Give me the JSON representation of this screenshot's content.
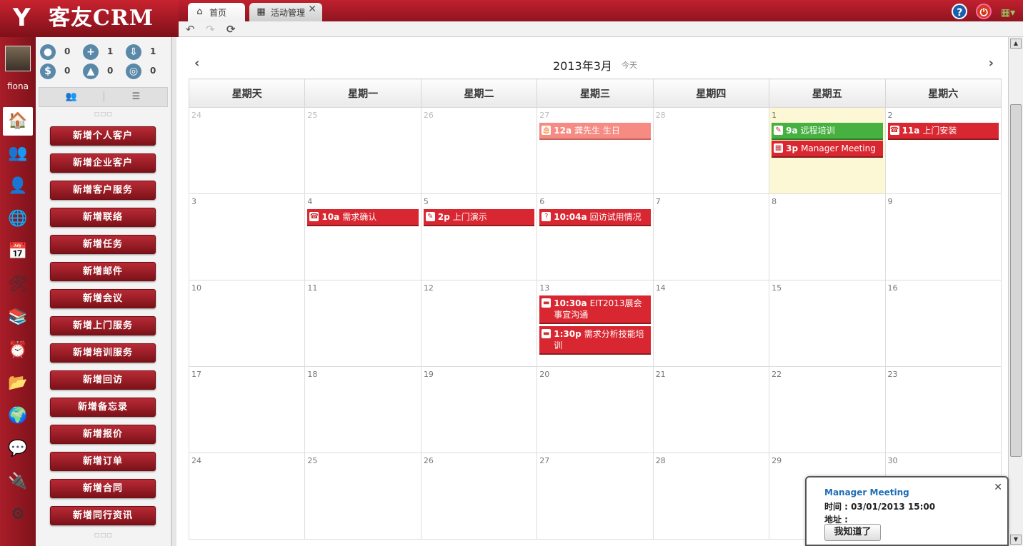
{
  "app": {
    "logo_mark": "Y",
    "name": "客友CRM"
  },
  "tabs": [
    {
      "label": "首页",
      "icon": "home-icon"
    },
    {
      "label": "活动管理",
      "icon": "calendar-icon",
      "close": "✕"
    }
  ],
  "toolbar": {
    "back": "↶",
    "forward": "↷",
    "refresh": "⟳"
  },
  "header_icons": {
    "help": "?",
    "power": "⏻",
    "theme": "▦▾"
  },
  "user": {
    "name": "fiona"
  },
  "nav_icons": [
    "home-icon",
    "contacts-icon",
    "customer-icon",
    "globe-clock-icon",
    "calendar-icon",
    "tools-icon",
    "layers-icon",
    "clock-icon",
    "folder-icon",
    "world-icon",
    "chat-icon",
    "usb-icon",
    "gear-icon"
  ],
  "stats": [
    {
      "icon": "person-icon",
      "glyph": "●",
      "count": "0"
    },
    {
      "icon": "plus-icon",
      "glyph": "+",
      "count": "1"
    },
    {
      "icon": "inbox-icon",
      "glyph": "⇩",
      "count": "1"
    },
    {
      "icon": "dollar-icon",
      "glyph": "$",
      "count": "0"
    },
    {
      "icon": "bell-icon",
      "glyph": "▲",
      "count": "0"
    },
    {
      "icon": "alarm-icon",
      "glyph": "◎",
      "count": "0"
    }
  ],
  "panel_tabs": {
    "left": "👥",
    "right": "☰"
  },
  "actions": [
    "新增个人客户",
    "新增企业客户",
    "新增客户服务",
    "新增联络",
    "新增任务",
    "新增邮件",
    "新增会议",
    "新增上门服务",
    "新增培训服务",
    "新增回访",
    "新增备忘录",
    "新增报价",
    "新增订单",
    "新增合同",
    "新增同行资讯"
  ],
  "calendar": {
    "title": "2013年3月",
    "today": "今天",
    "prev": "‹",
    "next": "›",
    "weekdays": [
      "星期天",
      "星期一",
      "星期二",
      "星期三",
      "星期四",
      "星期五",
      "星期六"
    ],
    "weeks": [
      [
        {
          "d": "24",
          "other": true
        },
        {
          "d": "25",
          "other": true
        },
        {
          "d": "26",
          "other": true
        },
        {
          "d": "27",
          "other": true,
          "events": [
            {
              "time": "12a",
              "title": "龚先生 生日",
              "color": "pink",
              "icon": "🎂"
            }
          ]
        },
        {
          "d": "28",
          "other": true
        },
        {
          "d": "1",
          "today": true,
          "events": [
            {
              "time": "9a",
              "title": "远程培训",
              "color": "green",
              "icon": "✎"
            },
            {
              "time": "3p",
              "title": "Manager Meeting",
              "color": "red",
              "icon": "▦"
            }
          ]
        },
        {
          "d": "2",
          "events": [
            {
              "time": "11a",
              "title": "上门安装",
              "color": "red",
              "icon": "☎"
            }
          ]
        }
      ],
      [
        {
          "d": "3"
        },
        {
          "d": "4",
          "events": [
            {
              "time": "10a",
              "title": "需求确认",
              "color": "red",
              "icon": "☎"
            }
          ]
        },
        {
          "d": "5",
          "events": [
            {
              "time": "2p",
              "title": "上门演示",
              "color": "red",
              "icon": "✎"
            }
          ]
        },
        {
          "d": "6",
          "events": [
            {
              "time": "10:04a",
              "title": "回访试用情况",
              "color": "red",
              "icon": "?"
            }
          ]
        },
        {
          "d": "7"
        },
        {
          "d": "8"
        },
        {
          "d": "9"
        }
      ],
      [
        {
          "d": "10"
        },
        {
          "d": "11"
        },
        {
          "d": "12"
        },
        {
          "d": "13",
          "events": [
            {
              "time": "10:30a",
              "title": "EIT2013展会事宜沟通",
              "color": "red",
              "icon": "▬"
            },
            {
              "time": "1:30p",
              "title": "需求分析技能培训",
              "color": "red",
              "icon": "▬"
            }
          ]
        },
        {
          "d": "14"
        },
        {
          "d": "15"
        },
        {
          "d": "16"
        }
      ],
      [
        {
          "d": "17"
        },
        {
          "d": "18"
        },
        {
          "d": "19"
        },
        {
          "d": "20"
        },
        {
          "d": "21"
        },
        {
          "d": "22"
        },
        {
          "d": "23"
        }
      ],
      [
        {
          "d": "24"
        },
        {
          "d": "25"
        },
        {
          "d": "26"
        },
        {
          "d": "27"
        },
        {
          "d": "28"
        },
        {
          "d": "29"
        },
        {
          "d": "30"
        }
      ]
    ]
  },
  "popup": {
    "title": "Manager Meeting",
    "time": "时间 : 03/01/2013 15:00",
    "address": "地址 :",
    "ok": "我知道了",
    "close": "✕"
  },
  "colors": {
    "brand": "#a81d28",
    "event_red": "#d92731",
    "event_green": "#46b040",
    "event_pink": "#f58b82",
    "today_bg": "#fcf7d4"
  }
}
